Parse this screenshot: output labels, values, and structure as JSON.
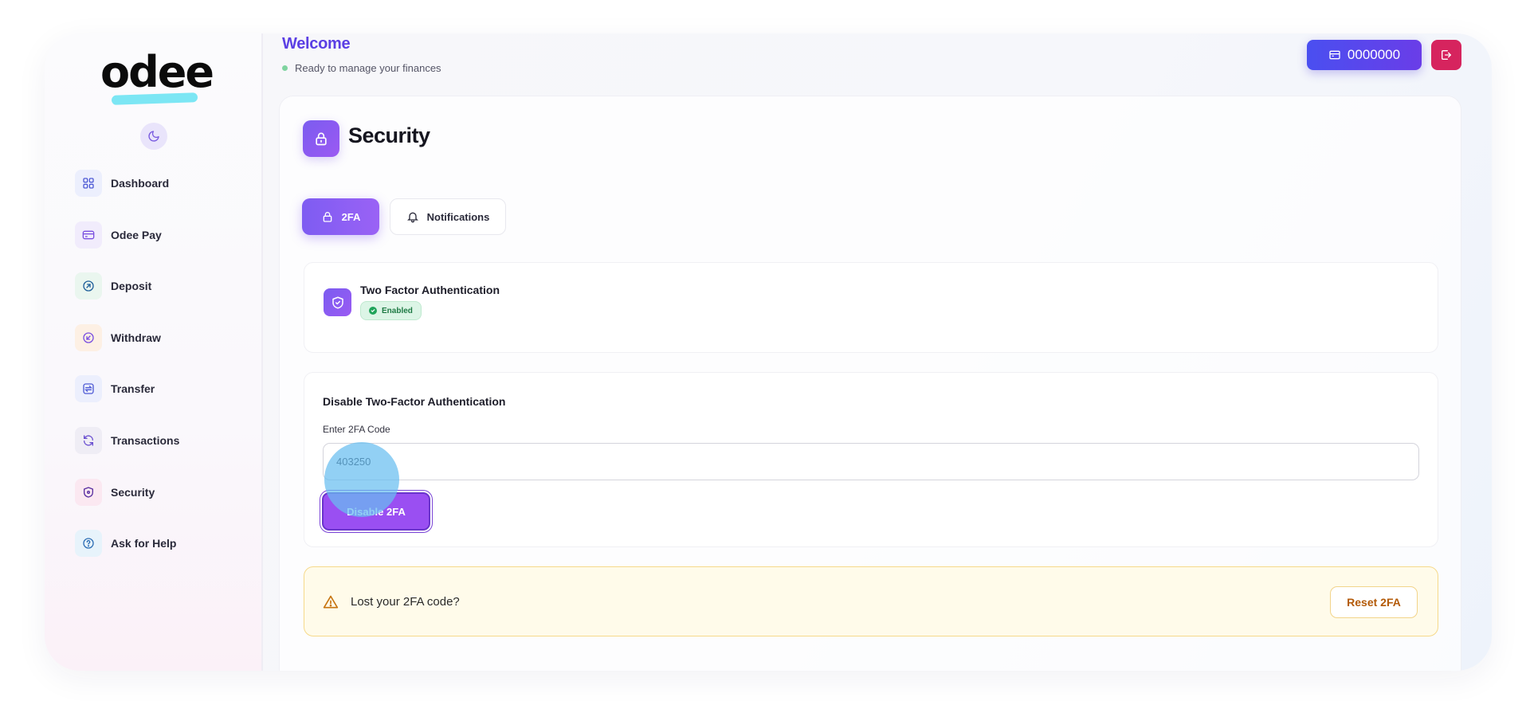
{
  "brand": {
    "logo_text": "odee"
  },
  "sidebar": {
    "items": [
      {
        "label": "Dashboard",
        "icon": "dashboard-grid-icon",
        "bg": "#eceffd",
        "fg": "#4f5bd5"
      },
      {
        "label": "Odee Pay",
        "icon": "card-icon",
        "bg": "#f1ecfc",
        "fg": "#7a4fe0"
      },
      {
        "label": "Deposit",
        "icon": "arrow-up-right-circle-icon",
        "bg": "#eaf6ef",
        "fg": "#1f5f9a"
      },
      {
        "label": "Withdraw",
        "icon": "arrow-down-left-circle-icon",
        "bg": "#fdf0e4",
        "fg": "#7a4fe0"
      },
      {
        "label": "Transfer",
        "icon": "transfer-icon",
        "bg": "#eceffd",
        "fg": "#4f5bd5"
      },
      {
        "label": "Transactions",
        "icon": "refresh-icon",
        "bg": "#efedf5",
        "fg": "#6a4fd0"
      },
      {
        "label": "Security",
        "icon": "shield-icon",
        "bg": "#fbe8f1",
        "fg": "#5a2fa0"
      },
      {
        "label": "Ask for Help",
        "icon": "help-circle-icon",
        "bg": "#e7f3fb",
        "fg": "#2f6fb5"
      }
    ]
  },
  "header": {
    "welcome": "Welcome",
    "status": "Ready to manage your finances",
    "account_number": "0000000"
  },
  "security": {
    "title": "Security",
    "tabs": [
      {
        "label": "2FA",
        "active": true
      },
      {
        "label": "Notifications",
        "active": false
      }
    ],
    "twofa": {
      "title": "Two Factor Authentication",
      "badge": "Enabled"
    },
    "disable": {
      "title": "Disable Two-Factor Authentication",
      "code_label": "Enter 2FA Code",
      "code_value": "403250",
      "button": "Disable 2FA"
    },
    "lost": {
      "text": "Lost your 2FA code?",
      "button": "Reset 2FA"
    }
  },
  "colors": {
    "accent": "#7e5cf2",
    "welcome": "#5b3fe4",
    "logout": "#d6245e",
    "warning": "#b35a08"
  }
}
